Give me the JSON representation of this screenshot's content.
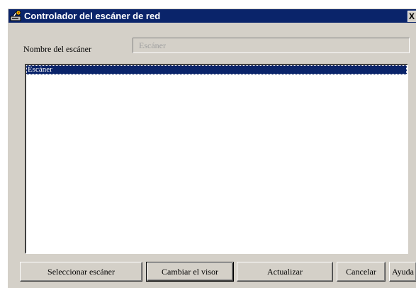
{
  "window": {
    "title": "Controlador del escáner de red",
    "close_label": "X",
    "title_bar_color": "#0a246a",
    "face_color": "#d4d0c8"
  },
  "scanner_name": {
    "label": "Nombre del escáner",
    "value": "Escáner"
  },
  "scanner_list": {
    "items": [
      {
        "label": "Escáner",
        "selected": true
      }
    ]
  },
  "buttons": {
    "select_scanner": "Seleccionar escáner",
    "change_viewer": "Cambiar el visor",
    "refresh": "Actualizar",
    "cancel": "Cancelar",
    "help": "Ayuda"
  },
  "icons": {
    "app": "scanner-app-icon"
  }
}
